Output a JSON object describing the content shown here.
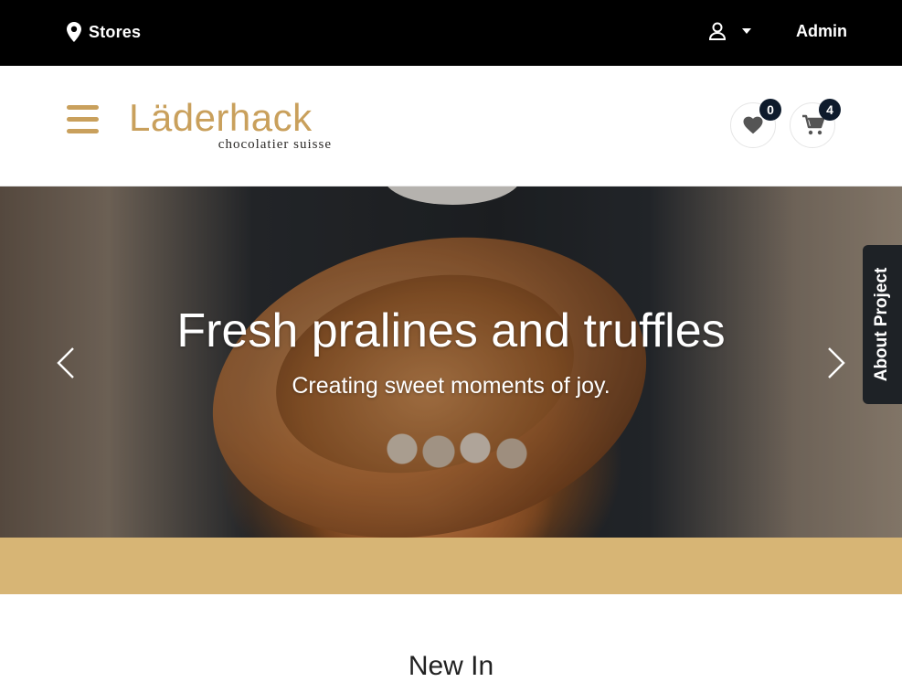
{
  "topbar": {
    "stores_label": "Stores",
    "user_icon": "user-icon",
    "user_dropdown_icon": "caret-down-icon",
    "admin_label": "Admin"
  },
  "header": {
    "menu_icon": "hamburger-icon",
    "logo": {
      "brand": "Läderhack",
      "tagline": "chocolatier suisse"
    },
    "wishlist": {
      "icon": "heart-icon",
      "count": "0"
    },
    "cart": {
      "icon": "cart-icon",
      "count": "4"
    }
  },
  "hero": {
    "title": "Fresh pralines and truffles",
    "subtitle": "Creating sweet moments of joy.",
    "prev_icon": "chevron-left-icon",
    "next_icon": "chevron-right-icon"
  },
  "side_tab": {
    "label": "About Project"
  },
  "section": {
    "title": "New In"
  },
  "colors": {
    "topbar_bg": "#000000",
    "brand_gold": "#c9a05c",
    "band_gold": "#d7b575",
    "badge_bg": "#0e1b2c",
    "side_tab_bg": "#1e2226"
  }
}
